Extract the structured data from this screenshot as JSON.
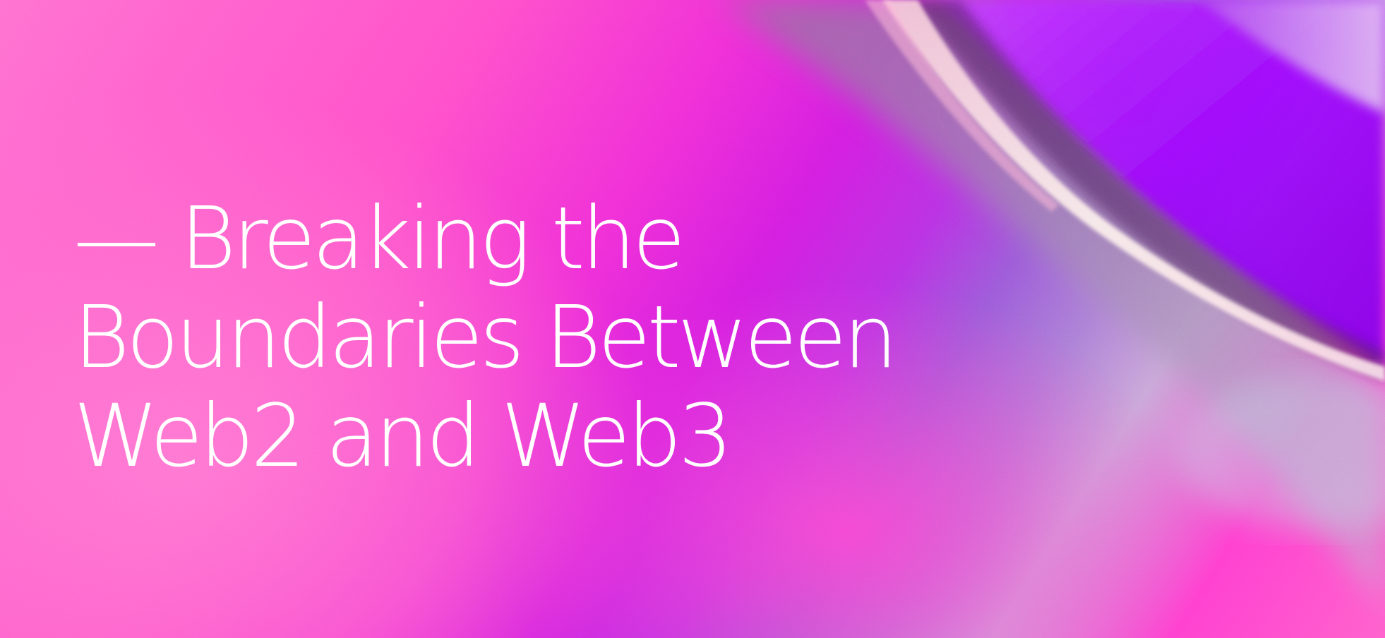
{
  "hero": {
    "headline_lines": [
      "— Breaking the",
      "Boundaries Between",
      "Web2 and Web3"
    ]
  },
  "colors": {
    "hot_pink": "#ff4fc9",
    "magenta": "#d31ee0",
    "violet": "#9b00ff",
    "lavender": "#c9a6d8",
    "text": "#ffffff"
  }
}
